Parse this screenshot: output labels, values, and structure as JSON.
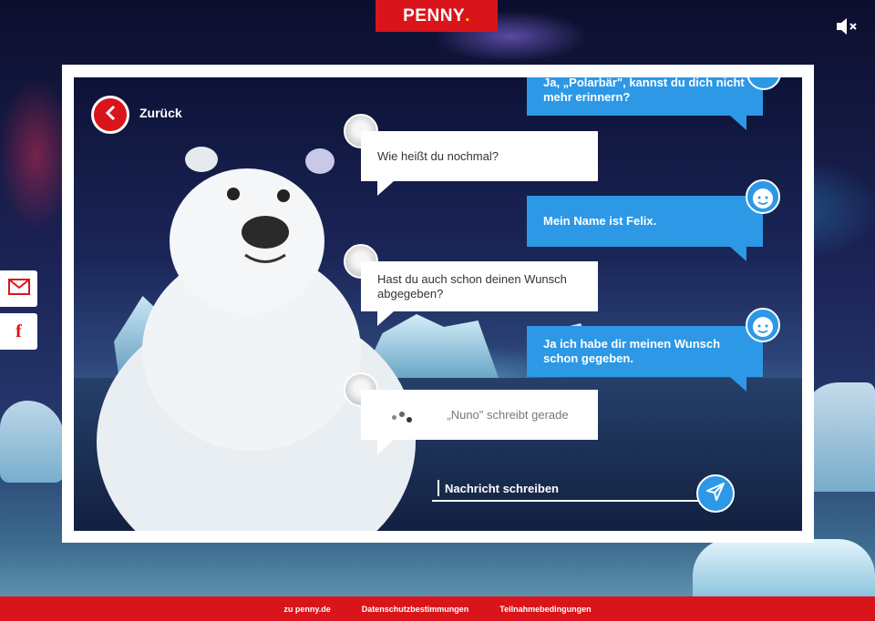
{
  "brand": {
    "logo_text": "PENNY",
    "logo_dot": ".",
    "accent": "#d9151b",
    "chat_blue": "#2d98e6"
  },
  "controls": {
    "mute_icon": "speaker-muted-icon",
    "email_icon": "envelope-icon",
    "facebook_icon": "facebook-icon",
    "facebook_glyph": "f"
  },
  "nav": {
    "back_label": "Zurück"
  },
  "chat": {
    "messages": [
      {
        "from": "user",
        "text": "Ja, „Polarbär\", kannst du dich nicht mehr erinnern?"
      },
      {
        "from": "bot",
        "text": "Wie heißt du nochmal?"
      },
      {
        "from": "user",
        "text": "Mein Name ist Felix."
      },
      {
        "from": "bot",
        "text": "Hast du auch schon deinen Wunsch abgegeben?"
      },
      {
        "from": "user",
        "text": "Ja ich habe dir meinen Wunsch schon gegeben."
      }
    ],
    "typing_text": "„Nuno\" schreibt gerade",
    "input_placeholder": "Nachricht schreiben"
  },
  "footer": {
    "links": [
      "zu penny.de",
      "Datenschutzbestimmungen",
      "Teilnahmebedingungen"
    ]
  }
}
